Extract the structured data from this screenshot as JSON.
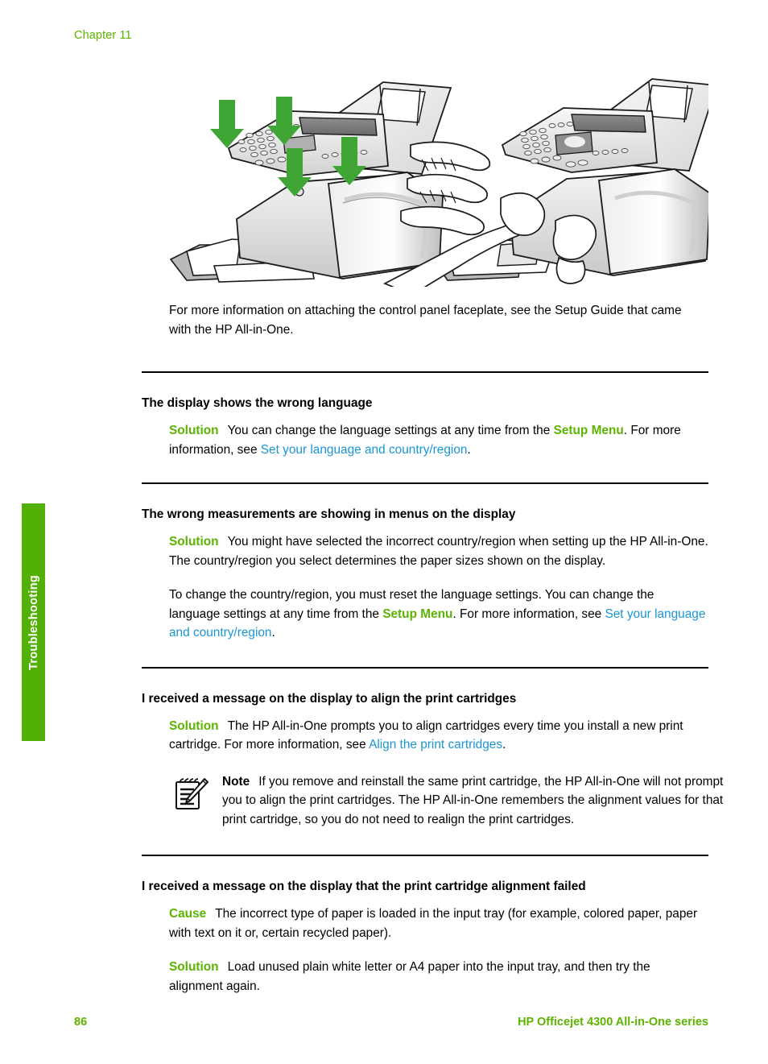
{
  "colors": {
    "brand_green": "#5CB300",
    "tab_green": "#53b006",
    "link_blue": "#1B96D2",
    "rule_black": "#000000",
    "arrow_green": "#3FA535"
  },
  "header": {
    "chapter": "Chapter 11"
  },
  "side_tab": {
    "label": "Troubleshooting"
  },
  "figure": {
    "left_caption_icon": "printer-faceplate-install-arrows",
    "right_caption_icon": "hands-pressing-faceplate",
    "arrow_count": 4
  },
  "intro": {
    "text": "For more information on attaching the control panel faceplate, see the Setup Guide that came with the HP All-in-One."
  },
  "sections": [
    {
      "heading": "The display shows the wrong language",
      "blocks": [
        {
          "label": "Solution",
          "label_style": "solution",
          "runs": [
            {
              "t": "You can change the language settings at any time from the ",
              "s": "plain"
            },
            {
              "t": "Setup Menu",
              "s": "green-bold"
            },
            {
              "t": ". For more information, see ",
              "s": "plain"
            },
            {
              "t": "Set your language and country/region",
              "s": "link"
            },
            {
              "t": ".",
              "s": "plain"
            }
          ]
        }
      ]
    },
    {
      "heading": "The wrong measurements are showing in menus on the display",
      "blocks": [
        {
          "label": "Solution",
          "label_style": "solution",
          "runs": [
            {
              "t": "You might have selected the incorrect country/region when setting up the HP All-in-One. The country/region you select determines the paper sizes shown on the display.",
              "s": "plain"
            }
          ]
        },
        {
          "label": "",
          "label_style": "none",
          "runs": [
            {
              "t": "To change the country/region, you must reset the language settings. You can change the language settings at any time from the ",
              "s": "plain"
            },
            {
              "t": "Setup Menu",
              "s": "green-bold"
            },
            {
              "t": ". For more information, see ",
              "s": "plain"
            },
            {
              "t": "Set your language and country/region",
              "s": "link"
            },
            {
              "t": ".",
              "s": "plain"
            }
          ]
        }
      ]
    },
    {
      "heading": "I received a message on the display to align the print cartridges",
      "blocks": [
        {
          "label": "Solution",
          "label_style": "solution",
          "runs": [
            {
              "t": "The HP All-in-One prompts you to align cartridges every time you install a new print cartridge. For more information, see ",
              "s": "plain"
            },
            {
              "t": "Align the print cartridges",
              "s": "link"
            },
            {
              "t": ".",
              "s": "plain"
            }
          ]
        }
      ],
      "note": {
        "icon": "notepad-pencil-icon",
        "label": "Note",
        "text": "If you remove and reinstall the same print cartridge, the HP All-in-One will not prompt you to align the print cartridges. The HP All-in-One remembers the alignment values for that print cartridge, so you do not need to realign the print cartridges."
      }
    },
    {
      "heading": "I received a message on the display that the print cartridge alignment failed",
      "blocks": [
        {
          "label": "Cause",
          "label_style": "cause",
          "runs": [
            {
              "t": "The incorrect type of paper is loaded in the input tray (for example, colored paper, paper with text on it or, certain recycled paper).",
              "s": "plain"
            }
          ]
        },
        {
          "label": "Solution",
          "label_style": "solution",
          "runs": [
            {
              "t": "Load unused plain white letter or A4 paper into the input tray, and then try the alignment again.",
              "s": "plain"
            }
          ]
        }
      ]
    }
  ],
  "footer": {
    "page_number": "86",
    "product": "HP Officejet 4300 All-in-One series"
  }
}
